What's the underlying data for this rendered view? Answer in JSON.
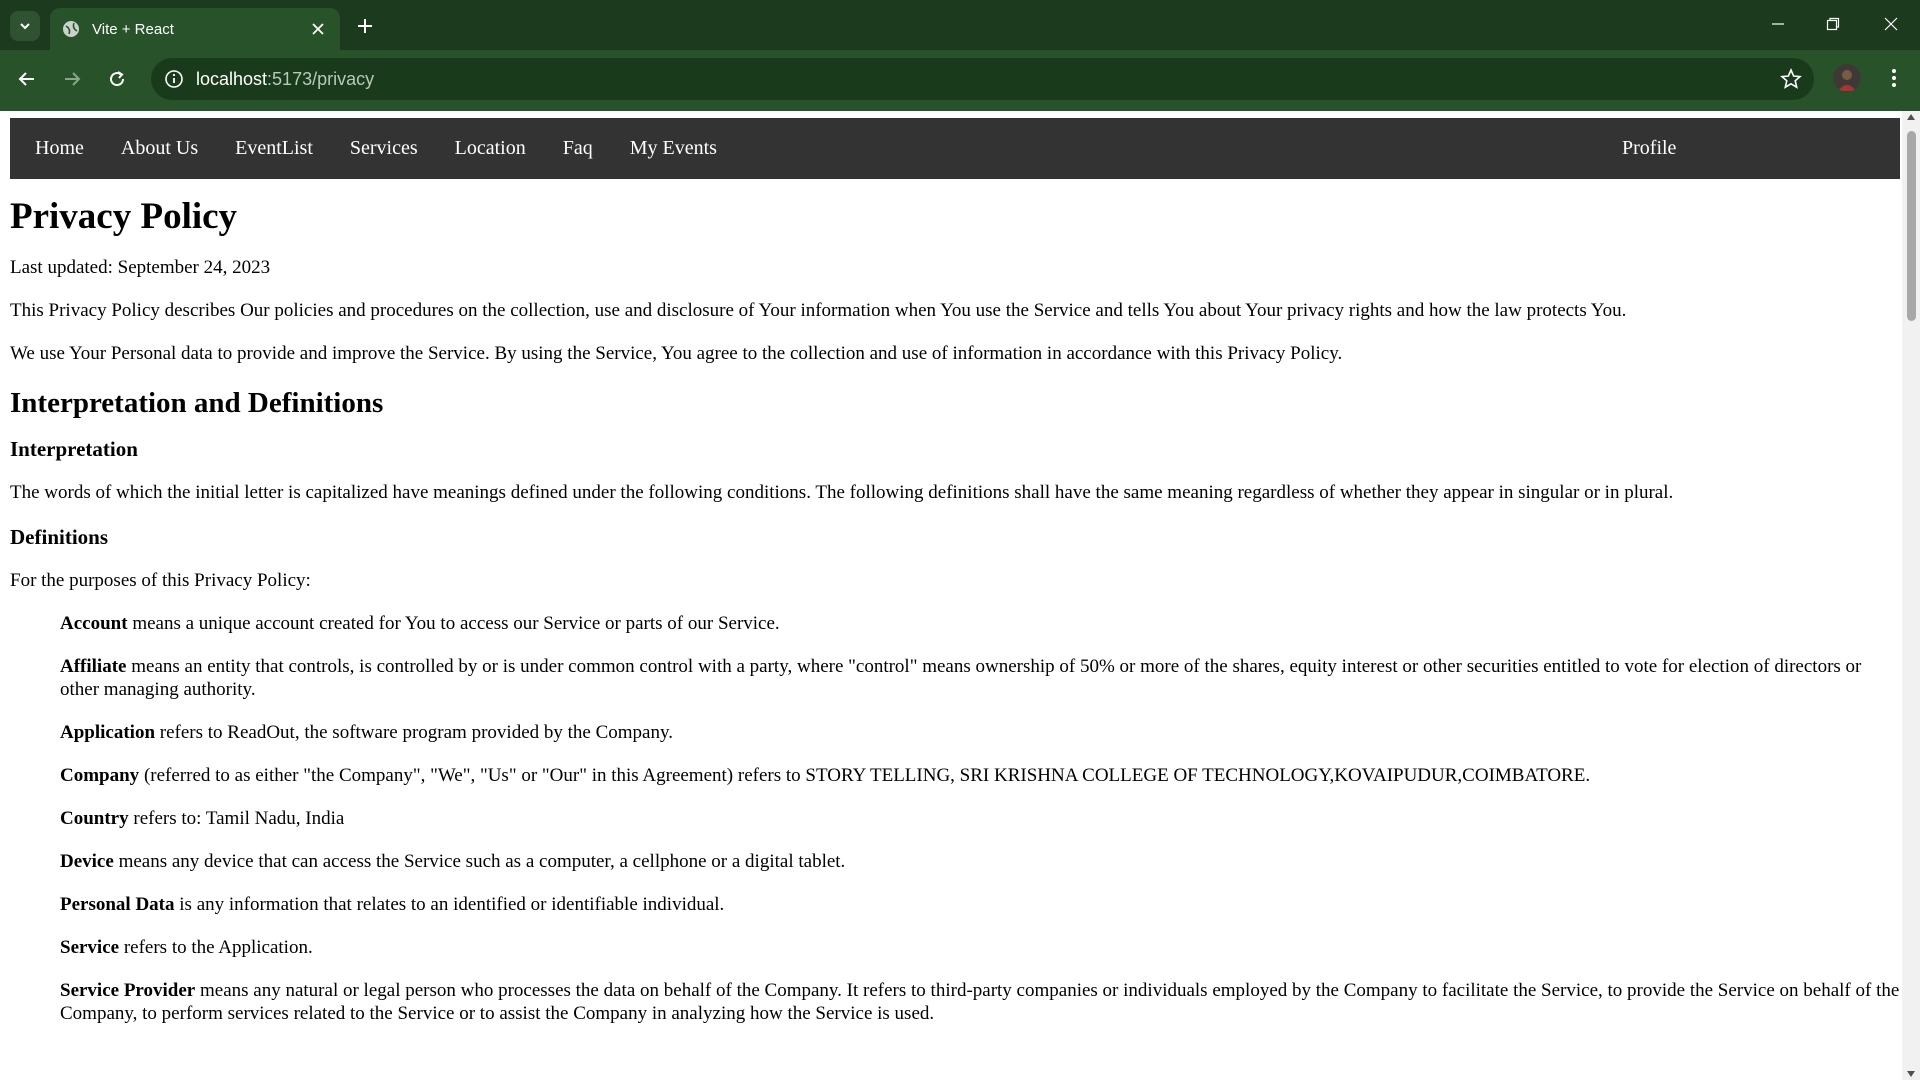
{
  "browser": {
    "tab_title": "Vite + React",
    "url_host": "localhost",
    "url_path": ":5173/privacy"
  },
  "nav": {
    "items": [
      {
        "label": "Home",
        "name": "nav-link-home"
      },
      {
        "label": "About Us",
        "name": "nav-link-about-us"
      },
      {
        "label": "EventList",
        "name": "nav-link-eventlist"
      },
      {
        "label": "Services",
        "name": "nav-link-services"
      },
      {
        "label": "Location",
        "name": "nav-link-location"
      },
      {
        "label": "Faq",
        "name": "nav-link-faq"
      },
      {
        "label": "My Events",
        "name": "nav-link-my-events"
      }
    ],
    "profile": "Profile",
    "bg_color": "#333333"
  },
  "content": {
    "title": "Privacy Policy",
    "last_updated": "Last updated: September 24, 2023",
    "intro_1": "This Privacy Policy describes Our policies and procedures on the collection, use and disclosure of Your information when You use the Service and tells You about Your privacy rights and how the law protects You.",
    "intro_2": "We use Your Personal data to provide and improve the Service. By using the Service, You agree to the collection and use of information in accordance with this Privacy Policy.",
    "h_interp_defs": "Interpretation and Definitions",
    "h_interpretation": "Interpretation",
    "interpretation_text": "The words of which the initial letter is capitalized have meanings defined under the following conditions. The following definitions shall have the same meaning regardless of whether they appear in singular or in plural.",
    "h_definitions": "Definitions",
    "definitions_intro": "For the purposes of this Privacy Policy:",
    "definitions": [
      {
        "term": "Account",
        "text": " means a unique account created for You to access our Service or parts of our Service."
      },
      {
        "term": "Affiliate",
        "text": " means an entity that controls, is controlled by or is under common control with a party, where \"control\" means ownership of 50% or more of the shares, equity interest or other securities entitled to vote for election of directors or other managing authority."
      },
      {
        "term": "Application",
        "text": " refers to ReadOut, the software program provided by the Company."
      },
      {
        "term": "Company",
        "text": " (referred to as either \"the Company\", \"We\", \"Us\" or \"Our\" in this Agreement) refers to STORY TELLING, SRI KRISHNA COLLEGE OF TECHNOLOGY,KOVAIPUDUR,COIMBATORE."
      },
      {
        "term": "Country",
        "text": " refers to: Tamil Nadu, India"
      },
      {
        "term": "Device",
        "text": " means any device that can access the Service such as a computer, a cellphone or a digital tablet."
      },
      {
        "term": "Personal Data",
        "text": " is any information that relates to an identified or identifiable individual."
      },
      {
        "term": "Service",
        "text": " refers to the Application."
      },
      {
        "term": "Service Provider",
        "text": " means any natural or legal person who processes the data on behalf of the Company. It refers to third-party companies or individuals employed by the Company to facilitate the Service, to provide the Service on behalf of the Company, to perform services related to the Service or to assist the Company in analyzing how the Service is used."
      }
    ]
  }
}
